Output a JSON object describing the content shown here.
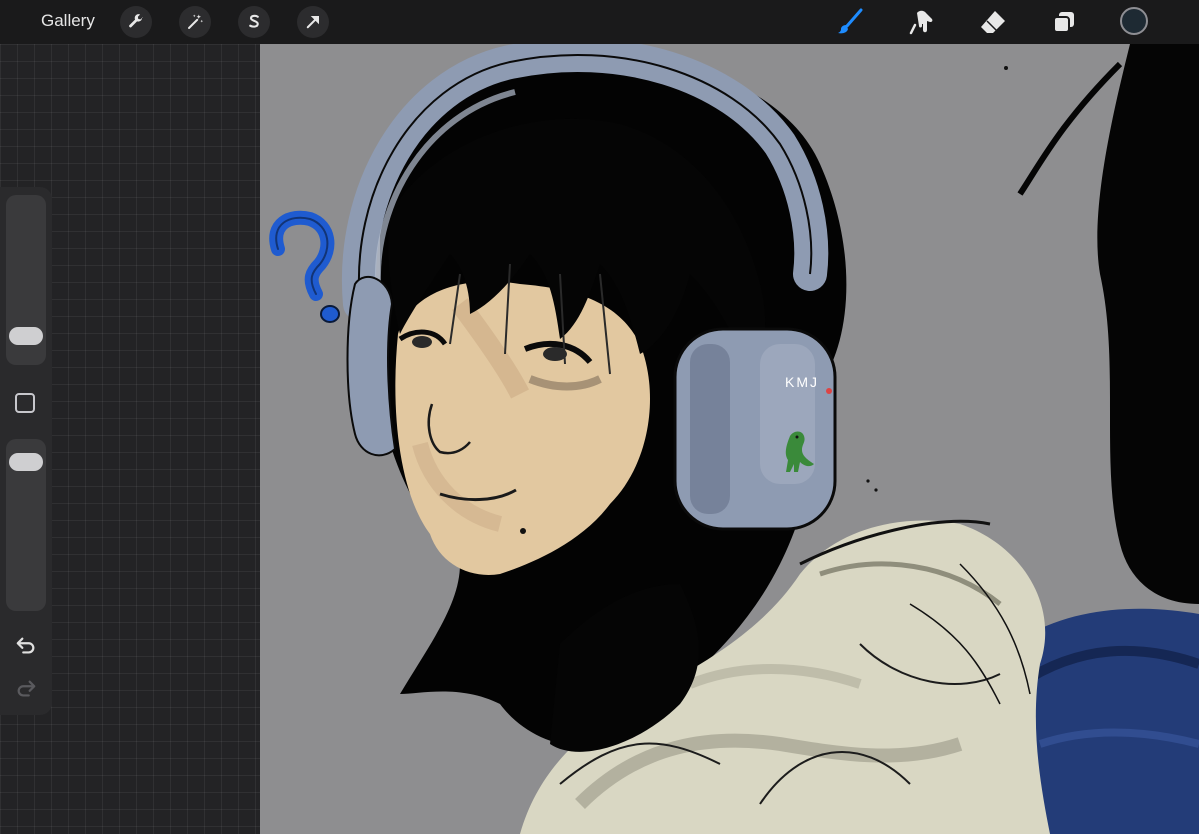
{
  "toolbar": {
    "gallery_label": "Gallery",
    "left_tools": [
      "wrench-icon",
      "magic-wand-icon",
      "selection-icon",
      "transform-arrow-icon"
    ],
    "right_tools": [
      "brush-icon",
      "smudge-icon",
      "eraser-icon",
      "layers-icon"
    ],
    "active_tool": "brush",
    "accent_color": "#1e8cff",
    "current_color": "#1e2a33"
  },
  "sidebar": {
    "brush_size_level": 0.08,
    "opacity_level": 0.93,
    "icons": [
      "modifier-square-icon",
      "undo-icon",
      "redo-icon"
    ]
  },
  "canvas": {
    "background_color": "#8e8e90",
    "headphone_text": "KMJ"
  }
}
